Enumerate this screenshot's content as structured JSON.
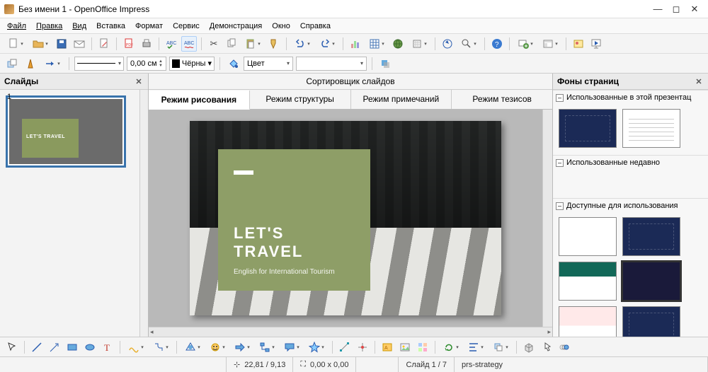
{
  "title": "Без имени 1 - OpenOffice Impress",
  "menu": {
    "file": "Файл",
    "edit": "Правка",
    "view": "Вид",
    "insert": "Вставка",
    "format": "Формат",
    "tools": "Сервис",
    "presentation": "Демонстрация",
    "window": "Окно",
    "help": "Справка"
  },
  "toolbar2": {
    "width_value": "0,00 см",
    "color_name": "Чёрны",
    "fill_mode": "Цвет"
  },
  "panels": {
    "slides_title": "Слайды",
    "backgrounds_title": "Фоны страниц"
  },
  "center": {
    "sorter_title": "Сортировщик слайдов",
    "tabs": {
      "drawing": "Режим рисования",
      "outline": "Режим структуры",
      "notes": "Режим примечаний",
      "handout": "Режим тезисов"
    }
  },
  "slide_content": {
    "headline": "LET'S TRAVEL",
    "subtitle": "English for International Tourism"
  },
  "thumb": {
    "number": "1",
    "mini_headline": "LET'S TRAVEL"
  },
  "bg_sections": {
    "used_in_pres": "Использованные в этой презентац",
    "recently_used": "Использованные недавно",
    "available": "Доступные для использования"
  },
  "status": {
    "coords": "22,81 / 9,13",
    "size": "0,00 x 0,00",
    "slide_counter": "Слайд 1 / 7",
    "template": "prs-strategy"
  }
}
